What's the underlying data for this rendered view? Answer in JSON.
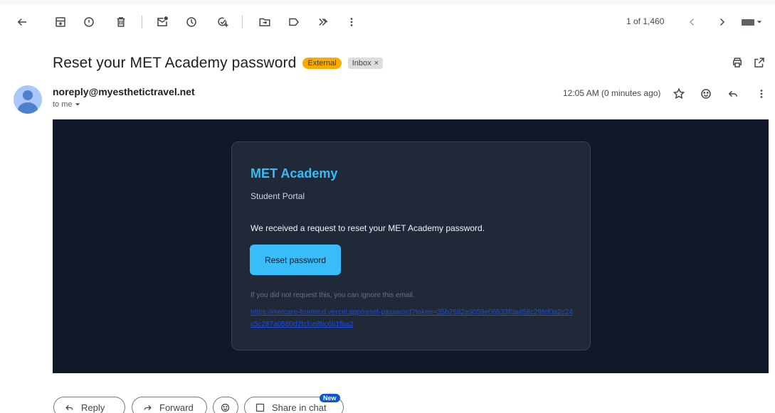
{
  "toolbar": {
    "icons": [
      "back-arrow-icon",
      "archive-icon",
      "report-spam-icon",
      "delete-icon",
      "mark-unread-icon",
      "snooze-icon",
      "add-to-tasks-icon",
      "move-to-icon",
      "label-icon",
      "forward-arrows-icon",
      "more-vert-icon"
    ],
    "pager_text": "1 of 1,460",
    "input_tools": "keyboard-icon"
  },
  "message": {
    "subject": "Reset your MET Academy password",
    "external_badge": "External",
    "inbox_badge": "Inbox",
    "inbox_badge_close": "×",
    "sender": "noreply@myesthetictravel.net",
    "to_me": "to me",
    "timestamp": "12:05 AM (0 minutes ago)"
  },
  "email": {
    "brand": "MET Academy",
    "portal": "Student Portal",
    "message": "We received a request to reset your MET Academy password.",
    "button": "Reset password",
    "ignore_text": "If you did not request this, you can ignore this email.",
    "link": "https://metcare-frontend.vercel.app/reset-password?token=35b2682a9059e06533f0a458c29fef0a2c24c5c287a0580d2fcfce8bc6b1fba2"
  },
  "actions": {
    "reply": "Reply",
    "forward": "Forward",
    "share": "Share in chat",
    "new_badge": "New"
  },
  "colors": {
    "email_bg": "#111827",
    "card_bg": "#1f2937",
    "accent": "#38bdf8",
    "link": "#1d4ed8",
    "external_badge": "#f9ab00",
    "new_badge": "#0b57d0"
  }
}
